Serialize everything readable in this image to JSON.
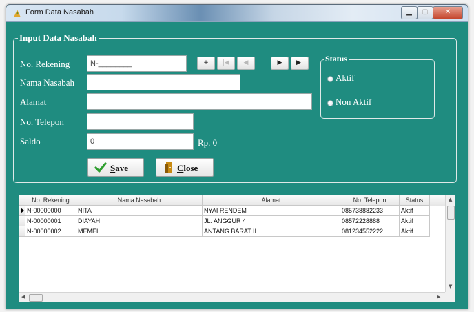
{
  "window": {
    "title": "Form Data Nasabah"
  },
  "input_group": {
    "legend": "Input Data Nasabah",
    "labels": {
      "rekening": "No. Rekening",
      "nama": "Nama Nasabah",
      "alamat": "Alamat",
      "telepon": "No. Telepon",
      "saldo": "Saldo"
    },
    "values": {
      "rekening": "N-________",
      "nama": "",
      "alamat": "",
      "telepon": "",
      "saldo": "0"
    },
    "saldo_suffix": "Rp. 0",
    "nav_icons": [
      "plus-icon",
      "first-record-icon",
      "previous-record-icon",
      "next-record-icon",
      "last-record-icon"
    ],
    "nav_glyphs": [
      "+",
      "|◀",
      "◀",
      "▶",
      "▶|"
    ]
  },
  "status_group": {
    "legend": "Status",
    "options": [
      "Aktif",
      "Non Aktif"
    ]
  },
  "buttons": {
    "save": {
      "accel": "S",
      "rest": "ave"
    },
    "close": {
      "accel": "C",
      "rest": "lose"
    }
  },
  "table": {
    "columns": [
      "No. Rekening",
      "Nama Nasabah",
      "Alamat",
      "No. Telepon",
      "Status"
    ],
    "rows": [
      [
        "N-00000000",
        "NITA",
        "NYAI RENDEM",
        "085738882233",
        "Aktif"
      ],
      [
        "N-00000001",
        "DIAYAH",
        "JL. ANGGUR 4",
        "08572228888",
        "Aktif"
      ],
      [
        "N-00000002",
        "MEMEL",
        "ANTANG BARAT II",
        "081234552222",
        "Aktif"
      ]
    ]
  },
  "colors": {
    "form_background": "#1f8c80",
    "label_text": "#ffffff",
    "check_icon": "#2e9e2e",
    "close_icon": "#c88a12"
  }
}
